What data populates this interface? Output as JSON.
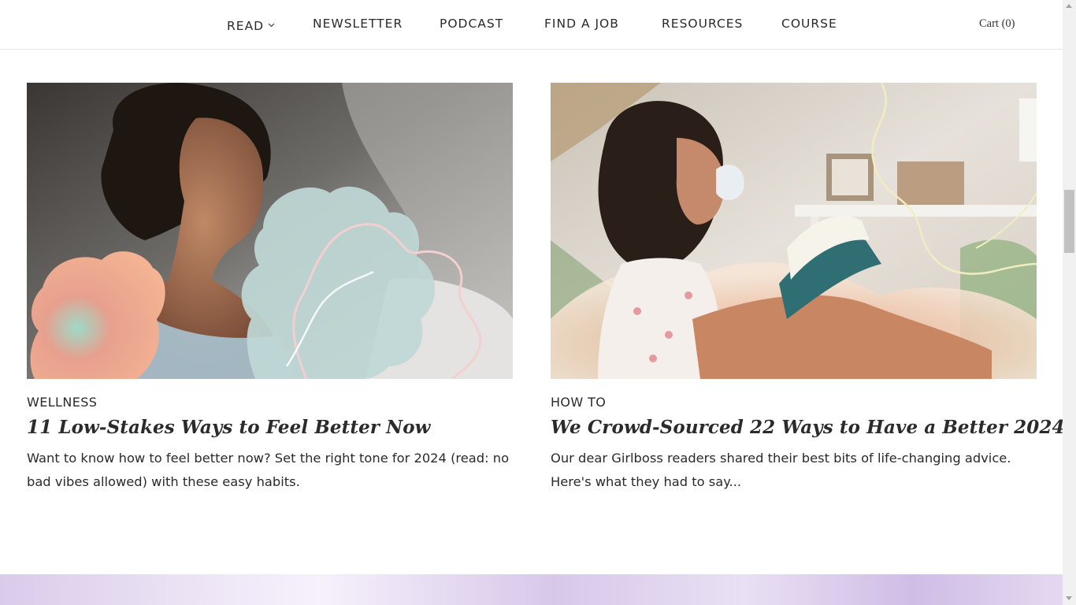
{
  "nav": {
    "items": [
      {
        "label": "READ",
        "has_dropdown": true
      },
      {
        "label": "NEWSLETTER"
      },
      {
        "label": "PODCAST"
      },
      {
        "label": "FIND A JOB"
      },
      {
        "label": "RESOURCES"
      },
      {
        "label": "COURSE"
      }
    ],
    "cart_label": "Cart (0)"
  },
  "articles": [
    {
      "category": "WELLNESS",
      "title": "11 Low-Stakes Ways to Feel Better Now",
      "excerpt": "Want to know how to feel better now? Set the right tone for 2024 (read: no bad vibes allowed) with these easy habits."
    },
    {
      "category": "HOW TO",
      "title": "We Crowd-Sourced 22 Ways to Have a Better 2024",
      "excerpt": "Our dear Girlboss readers shared their best bits of life-changing advice. Here's what they had to say..."
    }
  ],
  "colors": {
    "text": "#2a2a2a",
    "banner_lavender": "#d9cbea",
    "blob_mint": "#bfd8d6",
    "blob_coral": "#f4a68e",
    "squiggle_pink": "#f7d6d6",
    "squiggle_cream": "#f3efc4"
  }
}
